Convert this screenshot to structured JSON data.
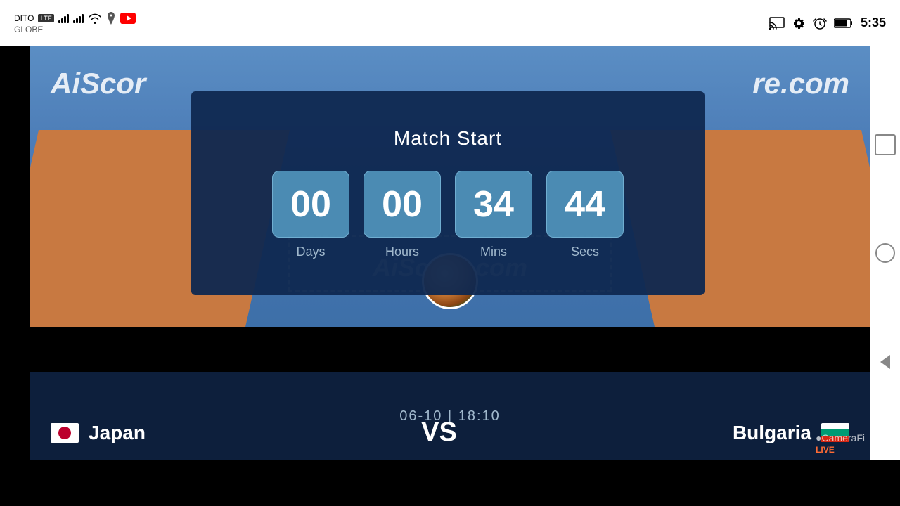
{
  "statusBar": {
    "carrier1": "DITO",
    "carrier2": "GLOBE",
    "lteBadge": "LTE",
    "time": "5:35",
    "batteryLevel": "80"
  },
  "modal": {
    "title": "Match Start",
    "countdown": {
      "days": {
        "value": "00",
        "label": "Days"
      },
      "hours": {
        "value": "00",
        "label": "Hours"
      },
      "mins": {
        "value": "34",
        "label": "Mins"
      },
      "secs": {
        "value": "44",
        "label": "Secs"
      }
    }
  },
  "match": {
    "date": "06-10",
    "time": "18:10",
    "separator": "|",
    "vs": "VS",
    "teamLeft": "Japan",
    "teamRight": "Bulgaria"
  },
  "watermarks": {
    "aiscoreLeft": "AiScor",
    "aiscoreRight": "re.com",
    "aiscoreCenter": "AiScore.com",
    "camerafi": "●CameraFi",
    "live": "LIVE"
  }
}
